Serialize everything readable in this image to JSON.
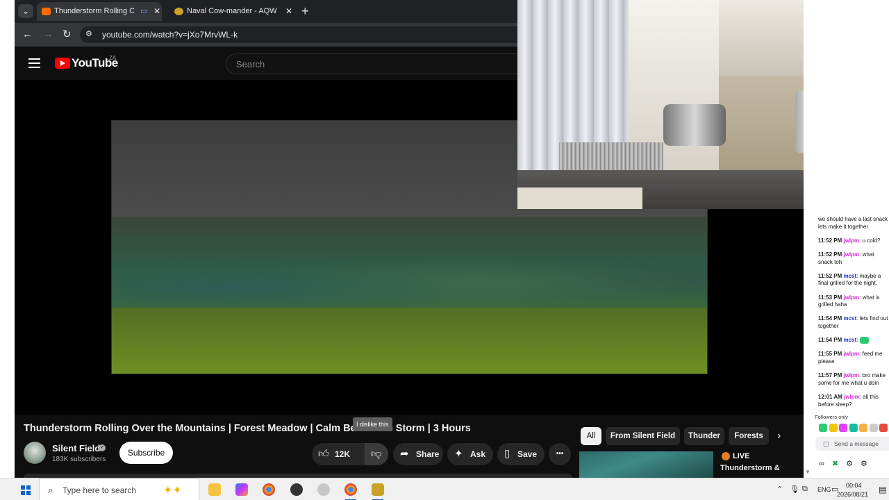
{
  "browser": {
    "tabs": [
      {
        "title": "Thunderstorm Rolling Over",
        "active": true,
        "favicon": "youtube-favicon"
      },
      {
        "title": "Naval Cow-mander - AQW",
        "active": false,
        "favicon": "aqw-favicon"
      }
    ],
    "tab_list_icon": "chevron-down-icon",
    "new_tab_label": "+",
    "close_label": "✕",
    "url": "youtube.com/watch?v=jXo7MrvWL-k"
  },
  "youtube": {
    "logo_text": "YouTube",
    "region": "ZA",
    "search_placeholder": "Search",
    "video_title": "Thunderstorm Rolling Over the Mountains | Forest Meadow | Calm Before the Storm | 3 Hours",
    "tooltip": "I dislike this",
    "channel": {
      "name": "Silent Field",
      "subscribers": "183K subscribers",
      "subscribe_label": "Subscribe"
    },
    "actions": {
      "likes": "12K",
      "share": "Share",
      "ask": "Ask",
      "save": "Save",
      "more": "•••"
    },
    "chips": [
      "All",
      "From Silent Field",
      "Thunder",
      "Forests"
    ],
    "recommendation": {
      "live_label": "LIVE",
      "title": "Thunderstorm &"
    }
  },
  "chat": {
    "messages": [
      {
        "time": "",
        "user": "",
        "text": "we should have a last snack lets make it together",
        "user_color": "magenta"
      },
      {
        "time": "11:52 PM",
        "user": "jwlpm",
        "text": ": u cold?",
        "user_color": "magenta"
      },
      {
        "time": "11:52 PM",
        "user": "jwlpm",
        "text": ": what snack toh",
        "user_color": "magenta"
      },
      {
        "time": "11:52 PM",
        "user": "mcst",
        "text": ": maybe a final grilled for the night.",
        "user_color": "blue"
      },
      {
        "time": "11:53 PM",
        "user": "jwlpm",
        "text": ": what is grilled haha",
        "user_color": "magenta"
      },
      {
        "time": "11:54 PM",
        "user": "mcst",
        "text": ": lets find out together",
        "user_color": "blue"
      },
      {
        "time": "11:54 PM",
        "user": "mcst",
        "text": ":",
        "user_color": "blue"
      },
      {
        "time": "11:55 PM",
        "user": "jwlpm",
        "text": ": feed me please",
        "user_color": "magenta"
      },
      {
        "time": "11:57 PM",
        "user": "jwlpm",
        "text": ": bro make some for me what u doin",
        "user_color": "magenta"
      },
      {
        "time": "12:01 AM",
        "user": "jwlpm",
        "text": ": all this before sleep?",
        "user_color": "magenta"
      }
    ],
    "followers_only": "Followers only",
    "send_placeholder": "Send a message"
  },
  "taskbar": {
    "search_placeholder": "Type here to search",
    "language": "ENG",
    "time": "00:04",
    "date": "2026/08/21"
  },
  "colors": {
    "youtube_red": "#ff0000",
    "chat_magenta": "#d62ad6",
    "chat_blue": "#2d2de0",
    "live_orange": "#e67e22",
    "windows_blue": "#0b64c4"
  }
}
